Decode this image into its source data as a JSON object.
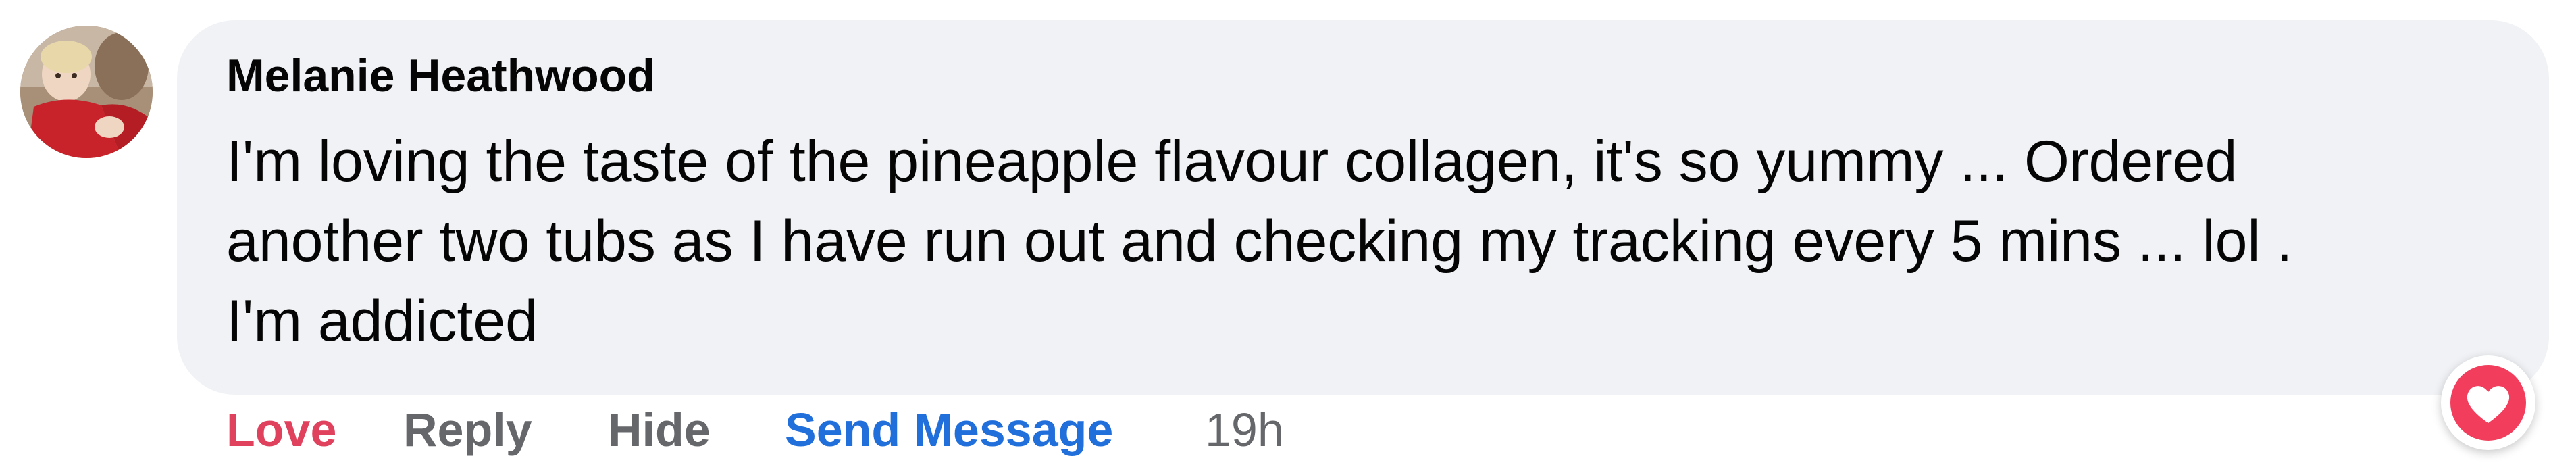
{
  "comment": {
    "author": "Melanie Heathwood",
    "text": "I'm loving the taste of the pineapple flavour collagen, it's so yummy ... Ordered\nanother two tubs as I have run out and checking my tracking every 5 mins ... lol .\nI'm addicted",
    "timestamp": "19h",
    "reaction_icon": "heart-reaction-icon"
  },
  "actions": {
    "love_label": "Love",
    "reply_label": "Reply",
    "hide_label": "Hide",
    "send_message_label": "Send Message"
  },
  "colors": {
    "bubble_bg": "#f0f2f5",
    "love": "#e0425e",
    "link": "#216fdb",
    "secondary_text": "#65676b",
    "primary_text": "#050505",
    "heart": "#f23e5c"
  }
}
